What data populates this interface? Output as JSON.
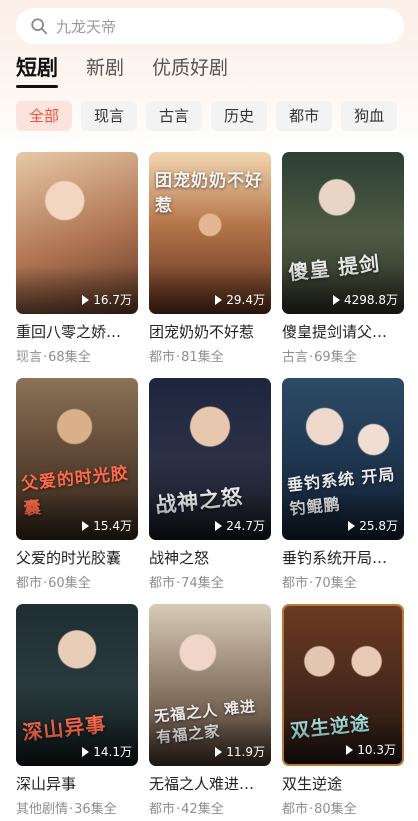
{
  "search": {
    "placeholder": "九龙天帝",
    "icon": "search-icon"
  },
  "tabs": [
    {
      "label": "短剧",
      "active": true
    },
    {
      "label": "新剧",
      "active": false
    },
    {
      "label": "优质好剧",
      "active": false
    }
  ],
  "categories": [
    {
      "label": "全部",
      "active": true
    },
    {
      "label": "现言"
    },
    {
      "label": "古言"
    },
    {
      "label": "历史"
    },
    {
      "label": "都市"
    },
    {
      "label": "狗血"
    }
  ],
  "cards": [
    {
      "title": "重回八零之娇…",
      "genre": "现言",
      "episodes": "68集全",
      "views": "16.7万"
    },
    {
      "title": "团宠奶奶不好惹",
      "genre": "都市",
      "episodes": "81集全",
      "views": "29.4万",
      "poster_text": "团宠奶奶不好惹"
    },
    {
      "title": "傻皇提剑请父…",
      "genre": "古言",
      "episodes": "69集全",
      "views": "4298.8万",
      "poster_text": "傻皇 提剑"
    },
    {
      "title": "父爱的时光胶囊",
      "genre": "都市",
      "episodes": "60集全",
      "views": "15.4万",
      "poster_text": "父爱的时光胶囊"
    },
    {
      "title": "战神之怒",
      "genre": "都市",
      "episodes": "74集全",
      "views": "24.7万",
      "poster_text": "战神之怒"
    },
    {
      "title": "垂钓系统开局…",
      "genre": "都市",
      "episodes": "70集全",
      "views": "25.8万",
      "poster_text": "垂钓系统 开局钓鲲鹏"
    },
    {
      "title": "深山异事",
      "genre": "其他剧情",
      "episodes": "36集全",
      "views": "14.1万",
      "poster_text": "深山异事"
    },
    {
      "title": "无福之人难进…",
      "genre": "都市",
      "episodes": "42集全",
      "views": "11.9万",
      "poster_text": "无福之人 难进有福之家"
    },
    {
      "title": "双生逆途",
      "genre": "都市",
      "episodes": "80集全",
      "views": "10.3万",
      "poster_text": "双生逆途"
    }
  ]
}
